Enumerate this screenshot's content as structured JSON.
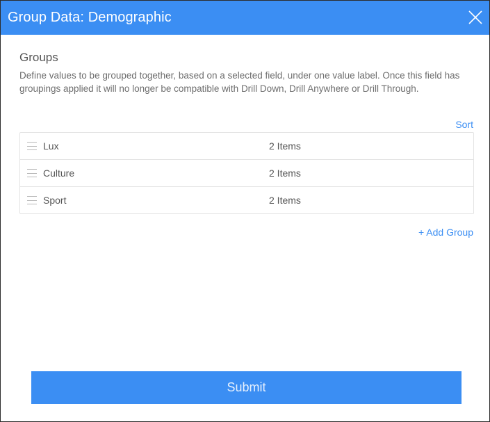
{
  "dialog": {
    "title": "Group Data: Demographic",
    "close_icon": "close-icon"
  },
  "groups": {
    "heading": "Groups",
    "description": "Define values to be grouped together, based on a selected field, under one value label. Once this field has groupings applied it will no longer be compatible with Drill Down, Drill Anywhere or Drill Through.",
    "sort_label": "Sort",
    "items": [
      {
        "name": "Lux",
        "count": "2 Items"
      },
      {
        "name": "Culture",
        "count": "2 Items"
      },
      {
        "name": "Sport",
        "count": "2 Items"
      }
    ],
    "add_label": "+ Add Group"
  },
  "footer": {
    "submit_label": "Submit"
  },
  "colors": {
    "accent": "#3b8ef3",
    "text": "#555555",
    "border": "#e3e3e3"
  }
}
